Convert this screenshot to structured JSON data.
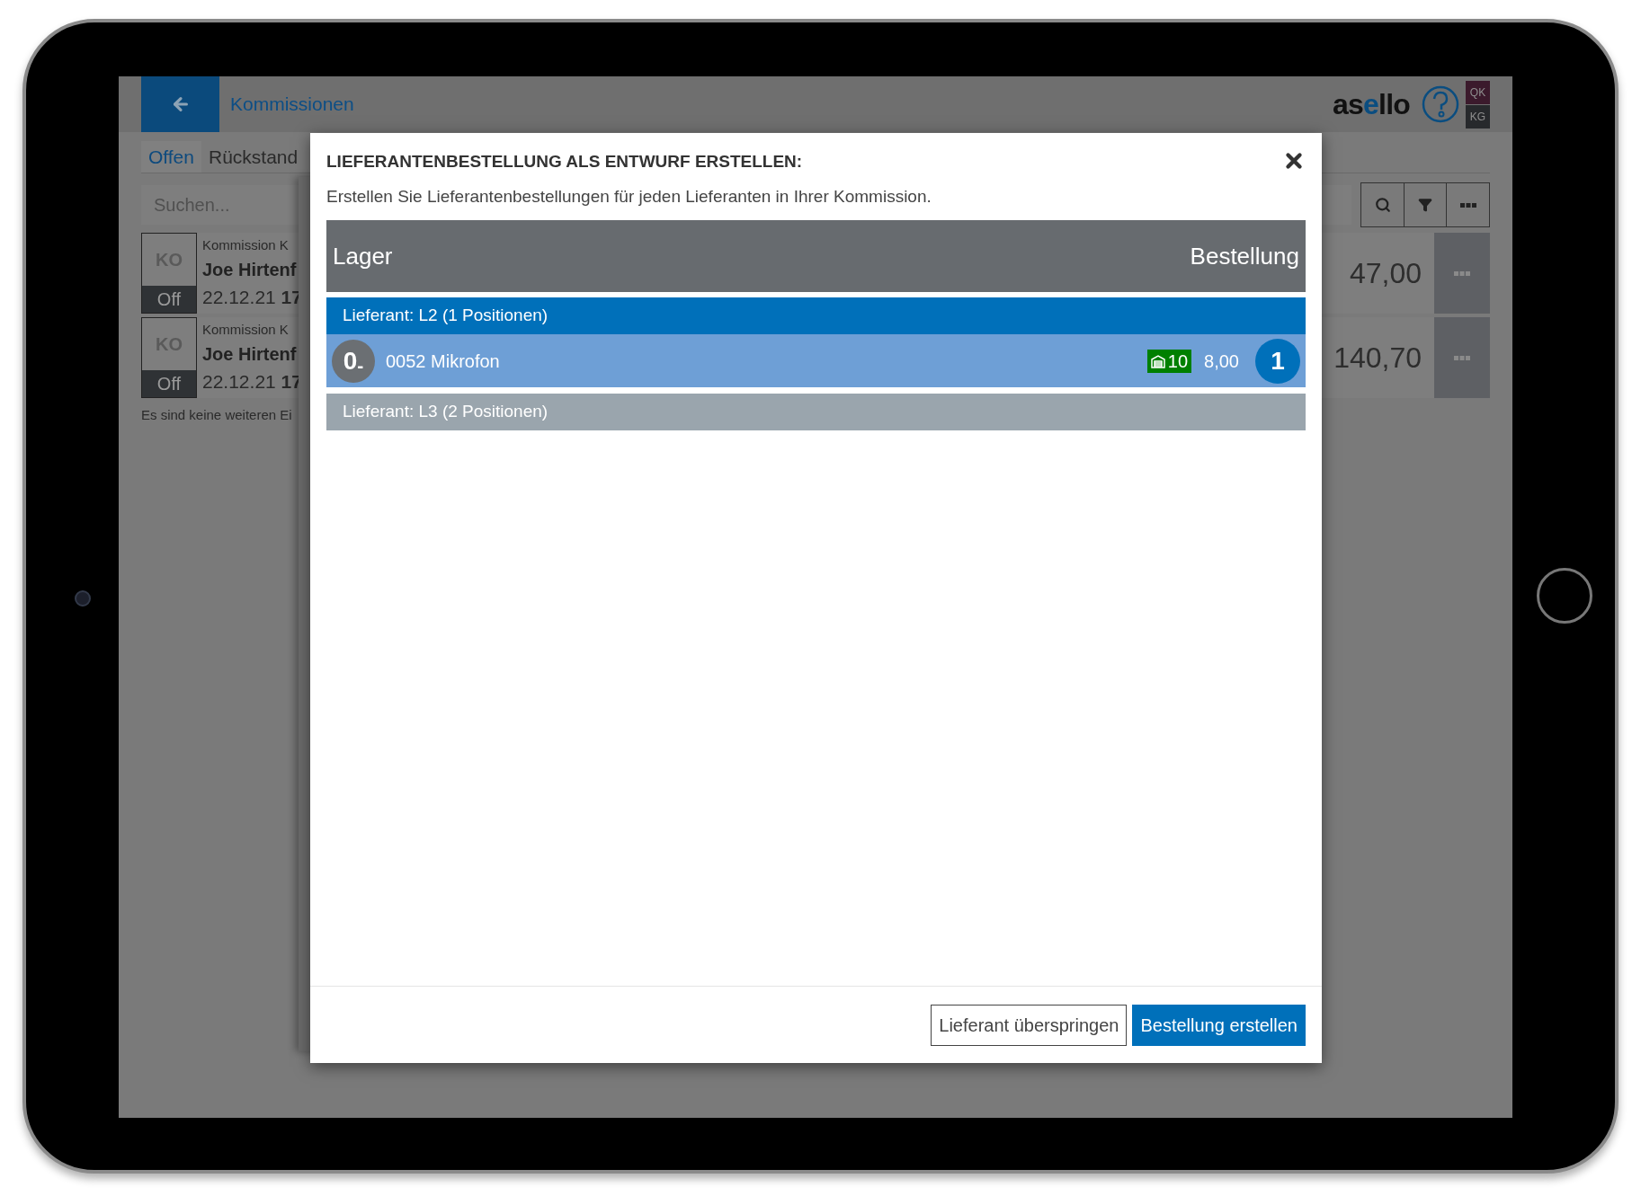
{
  "app": {
    "header": {
      "title": "Kommissionen",
      "logo": [
        {
          "text": "as",
          "accent": false
        },
        {
          "text": "e",
          "accent": true
        },
        {
          "text": "llo",
          "accent": false
        }
      ],
      "users": [
        {
          "label": "QK",
          "color": "#3b1a2c"
        },
        {
          "label": "KG",
          "color": "#27292c"
        }
      ]
    },
    "tabs": [
      {
        "label": "Offen",
        "selected": true
      },
      {
        "label": "Rückstand",
        "selected": false
      }
    ],
    "search": {
      "placeholder": "Suchen..."
    },
    "rows": [
      {
        "badge": "KO",
        "status": "Off",
        "title": "Kommission K",
        "customer": "Joe Hirtenf",
        "date": "22.12.21",
        "time": "17",
        "amount": "47,00"
      },
      {
        "badge": "KO",
        "status": "Off",
        "title": "Kommission K",
        "customer": "Joe Hirtenf",
        "date": "22.12.21",
        "time": "17",
        "amount": "140,70"
      }
    ],
    "footer_note": "Es sind keine weiteren Ei"
  },
  "dialog": {
    "title": "LIEFERANTENBESTELLUNG ALS ENTWURF ERSTELLEN:",
    "subtitle": "Erstellen Sie Lieferantenbestellungen für jeden Lieferanten in Ihrer Kommission.",
    "columns": [
      "Lager",
      "Bestellung"
    ],
    "groups": [
      {
        "label": "Lieferant: L2 (1 Positionen)",
        "selected": true,
        "items": [
          {
            "ordered": "0$_{-}$",
            "name": "0052 Mikrofon",
            "stock": "10",
            "price": "8,00",
            "quantity": "1"
          }
        ]
      },
      {
        "label": "Lieferant: L3 (2 Positionen)",
        "selected": false
      }
    ],
    "buttons": [
      {
        "label": "Lieferant überspringen",
        "kind": "secondary"
      },
      {
        "label": "Bestellung erstellen",
        "kind": "primary"
      }
    ]
  }
}
